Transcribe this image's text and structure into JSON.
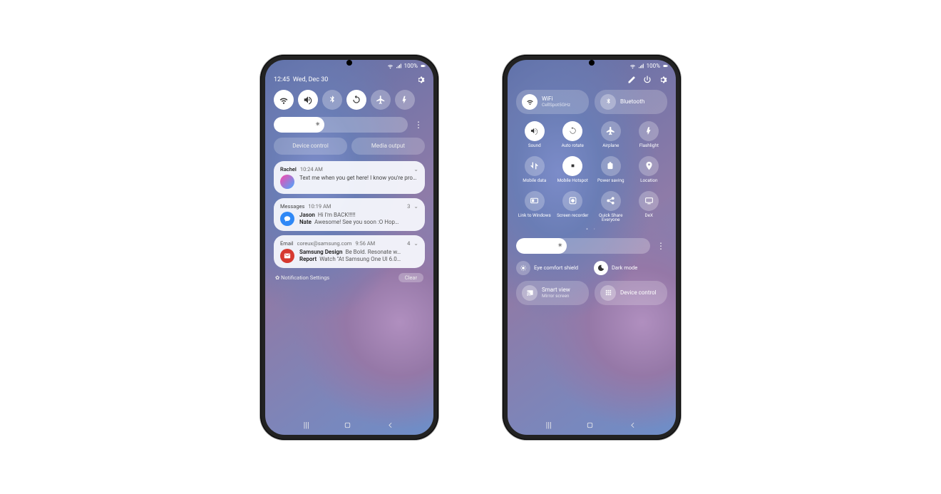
{
  "status": {
    "battery_text": "100%"
  },
  "left": {
    "time": "12:45",
    "date": "Wed, Dec 30",
    "quick": [
      "wifi",
      "sound",
      "bluetooth",
      "rotate",
      "airplane",
      "flashlight"
    ],
    "quick_active": [
      true,
      true,
      false,
      true,
      false,
      false
    ],
    "brightness_pct": 38,
    "pill1": "Device control",
    "pill2": "Media output",
    "notif1": {
      "sender": "Rachel",
      "time": "10:24 AM",
      "body": "Text me when you get here! I know you're probably having cravings. W…"
    },
    "notif2": {
      "app": "Messages",
      "time": "10:19 AM",
      "count": "3",
      "lines": [
        {
          "who": "Jason",
          "txt": "Hi I'm BACK!!!!!"
        },
        {
          "who": "Nate",
          "txt": "Awesome! See you soon :O Hop…"
        }
      ]
    },
    "notif3": {
      "app": "Email",
      "sub": "coreux@samsung.com",
      "time": "9:56 AM",
      "count": "4",
      "lines": [
        {
          "who": "Samsung Design",
          "txt": "Be Bold. Resonate w…"
        },
        {
          "who": "Report",
          "txt": "Watch \"At Samsung One UI 6.0…"
        }
      ]
    },
    "settings_link": "Notification Settings",
    "clear": "Clear"
  },
  "right": {
    "wifi": {
      "label": "WiFi",
      "sub": "CellSpot5GHz"
    },
    "bt": {
      "label": "Bluetooth"
    },
    "grid": [
      {
        "id": "sound",
        "label": "Sound",
        "on": true
      },
      {
        "id": "rotate",
        "label": "Auto rotate",
        "on": true
      },
      {
        "id": "airplane",
        "label": "Airplane",
        "on": false
      },
      {
        "id": "flashlight",
        "label": "Flashlight",
        "on": false
      },
      {
        "id": "mobiledata",
        "label": "Mobile data",
        "on": false
      },
      {
        "id": "hotspot",
        "label": "Mobile Hotspot",
        "on": true
      },
      {
        "id": "powersave",
        "label": "Power saving",
        "on": false
      },
      {
        "id": "location",
        "label": "Location",
        "on": false
      },
      {
        "id": "linkwin",
        "label": "Link to Windows",
        "on": false
      },
      {
        "id": "screenrec",
        "label": "Screen recorder",
        "on": false
      },
      {
        "id": "quickshare",
        "label": "Quick Share Everyone",
        "on": false
      },
      {
        "id": "dex",
        "label": "DeX",
        "on": false
      }
    ],
    "brightness_pct": 38,
    "eye": "Eye comfort shield",
    "dark": "Dark mode",
    "smartview": {
      "label": "Smart view",
      "sub": "Mirror screen"
    },
    "devicectrl": "Device control"
  }
}
